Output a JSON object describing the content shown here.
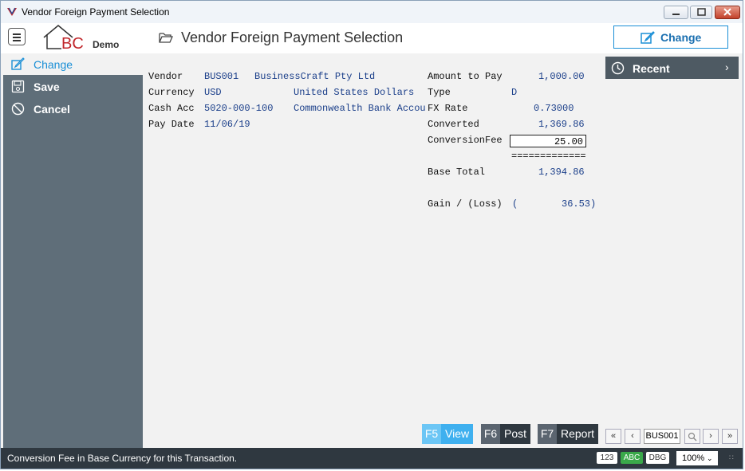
{
  "window": {
    "title": "Vendor Foreign Payment Selection"
  },
  "header": {
    "logo_text": "BC",
    "logo_sub": "Demo",
    "page_title": "Vendor Foreign Payment Selection",
    "change_button": "Change"
  },
  "sidebar": {
    "items": [
      {
        "label": "Change",
        "icon": "edit-icon"
      },
      {
        "label": "Save",
        "icon": "save-icon"
      },
      {
        "label": "Cancel",
        "icon": "cancel-icon"
      }
    ]
  },
  "form": {
    "vendor_label": "Vendor",
    "vendor_code": "BUS001",
    "vendor_name": "BusinessCraft Pty Ltd",
    "currency_label": "Currency",
    "currency_code": "USD",
    "currency_name": "United States Dollars",
    "cash_label": "Cash Acc",
    "cash_code": "5020-000-100",
    "cash_name": "Commonwealth Bank Accou",
    "paydate_label": "Pay Date",
    "paydate": "11/06/19",
    "amount_label": "Amount to Pay",
    "amount": "1,000.00",
    "type_label": "Type",
    "type": "D",
    "fx_label": "FX Rate",
    "fx": "0.73000",
    "converted_label": "Converted",
    "converted": "1,369.86",
    "fee_label": "ConversionFee",
    "fee": "25.00",
    "sep": "=============",
    "base_label": "Base Total",
    "base": "1,394.86",
    "gain_label": "Gain / (Loss)",
    "gain_open": "(",
    "gain": "36.53)"
  },
  "recent": {
    "label": "Recent"
  },
  "function_keys": [
    {
      "key": "F5",
      "label": "View"
    },
    {
      "key": "F6",
      "label": "Post"
    },
    {
      "key": "F7",
      "label": "Report"
    }
  ],
  "nav": {
    "record": "BUS001"
  },
  "status": {
    "message": "Conversion Fee in Base Currency for this Transaction.",
    "badge_123": "123",
    "badge_abc": "ABC",
    "badge_dbg": "DBG",
    "zoom": "100%"
  },
  "colors": {
    "accent": "#1a8fd6",
    "sidebar": "#5f6e79",
    "statusbar": "#2f3840"
  }
}
